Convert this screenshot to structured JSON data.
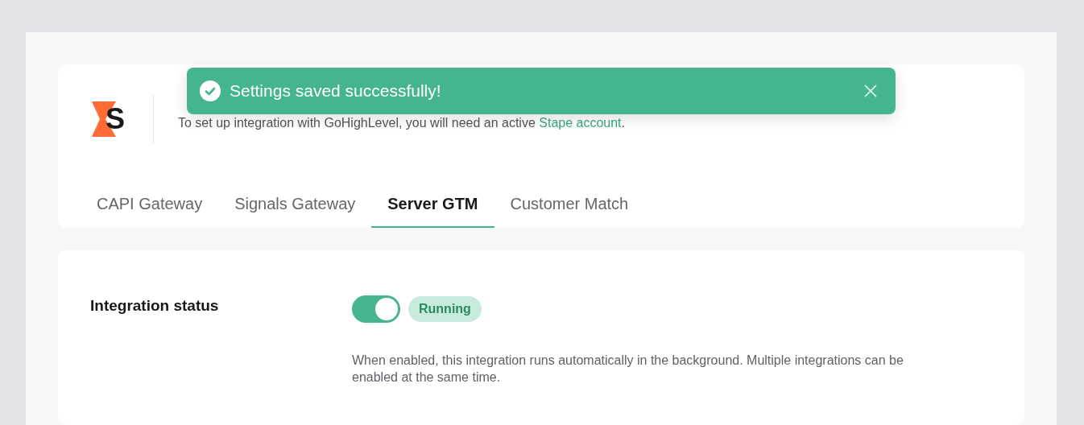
{
  "toast": {
    "message": "Settings saved successfully!",
    "kind": "success"
  },
  "header": {
    "logo_text": "S",
    "subtitle_before": "To set up integration with GoHighLevel, you will need an active ",
    "subtitle_link": "Stape account",
    "subtitle_after": "."
  },
  "tabs": [
    {
      "label": "CAPI Gateway",
      "selected": false
    },
    {
      "label": "Signals Gateway",
      "selected": false
    },
    {
      "label": "Server GTM",
      "selected": true
    },
    {
      "label": "Customer Match",
      "selected": false
    }
  ],
  "integration": {
    "label": "Integration status",
    "on": true,
    "status": "Running",
    "description": "When enabled, this integration runs automatically in the background. Multiple integrations can be enabled at the same time."
  }
}
